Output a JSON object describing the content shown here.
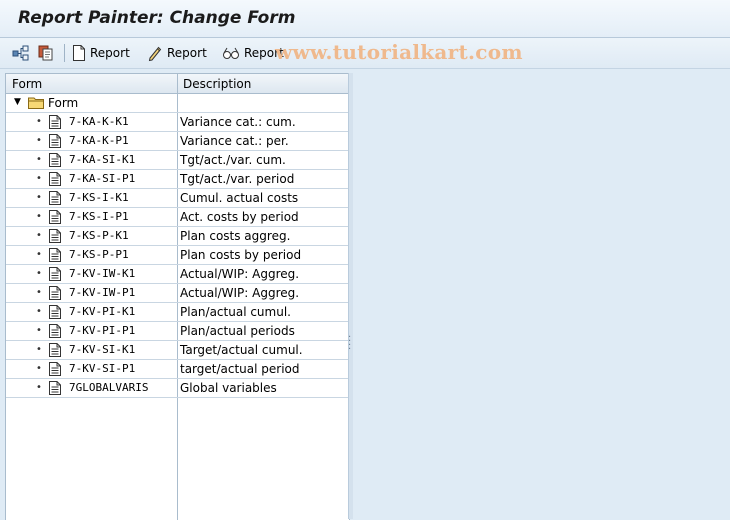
{
  "window": {
    "title": "Report Painter: Change Form"
  },
  "toolbar": {
    "buttons": [
      {
        "label": "Report",
        "icon": "create-document-icon"
      },
      {
        "label": "Report",
        "icon": "pencil-icon"
      },
      {
        "label": "Report",
        "icon": "glasses-icon"
      }
    ],
    "watermark": "www.tutorialkart.com"
  },
  "tree": {
    "columns": [
      "Form",
      "Description"
    ],
    "root": {
      "label": "Form",
      "icon": "folder-icon"
    },
    "items": [
      {
        "code": "7-KA-K-K1",
        "description": "Variance cat.: cum."
      },
      {
        "code": "7-KA-K-P1",
        "description": "Variance cat.: per."
      },
      {
        "code": "7-KA-SI-K1",
        "description": "Tgt/act./var. cum."
      },
      {
        "code": "7-KA-SI-P1",
        "description": "Tgt/act./var. period"
      },
      {
        "code": "7-KS-I-K1",
        "description": "Cumul. actual costs"
      },
      {
        "code": "7-KS-I-P1",
        "description": "Act. costs by period"
      },
      {
        "code": "7-KS-P-K1",
        "description": "Plan costs aggreg."
      },
      {
        "code": "7-KS-P-P1",
        "description": "Plan costs by period"
      },
      {
        "code": "7-KV-IW-K1",
        "description": "Actual/WIP: Aggreg."
      },
      {
        "code": "7-KV-IW-P1",
        "description": "Actual/WIP: Aggreg."
      },
      {
        "code": "7-KV-PI-K1",
        "description": "Plan/actual cumul."
      },
      {
        "code": "7-KV-PI-P1",
        "description": "Plan/actual periods"
      },
      {
        "code": "7-KV-SI-K1",
        "description": "Target/actual cumul."
      },
      {
        "code": "7-KV-SI-P1",
        "description": "target/actual period"
      },
      {
        "code": "7GLOBALVARIS",
        "description": "Global variables"
      }
    ]
  }
}
